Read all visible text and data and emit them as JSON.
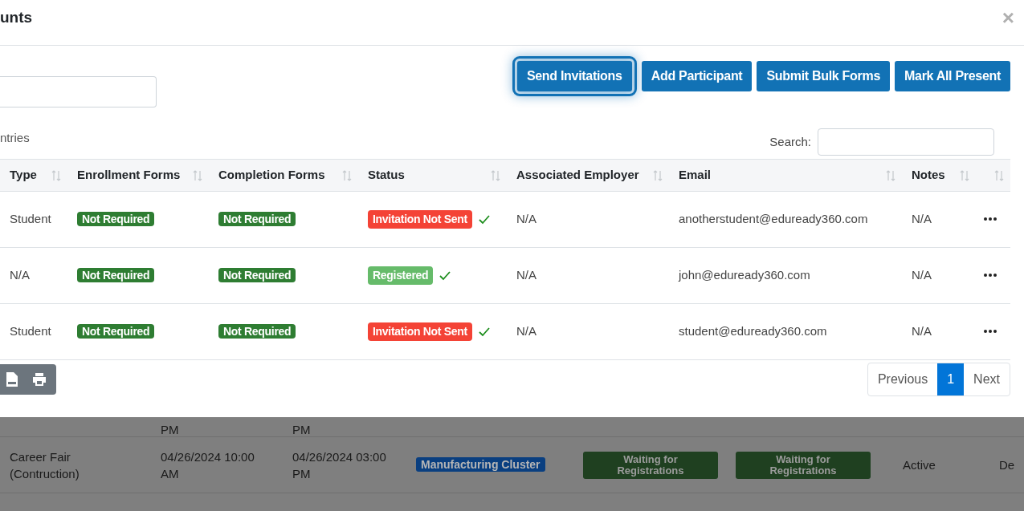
{
  "modal": {
    "title": "unts",
    "close": "×",
    "actions": [
      {
        "label": "Send Invitations",
        "focused": true
      },
      {
        "label": "Add Participant",
        "focused": false
      },
      {
        "label": "Submit Bulk Forms",
        "focused": false
      },
      {
        "label": "Mark All Present",
        "focused": false
      }
    ],
    "entries_label": "ntries",
    "search_label": "Search:",
    "columns": [
      "Type",
      "Enrollment Forms",
      "Completion Forms",
      "Status",
      "Associated Employer",
      "Email",
      "Notes",
      ""
    ],
    "rows": [
      {
        "type": "Student",
        "enrollment": "Not Required",
        "completion": "Not Required",
        "status": {
          "label": "Invitation Not Sent",
          "kind": "danger"
        },
        "employer": "N/A",
        "email": "anotherstudent@eduready360.com",
        "notes": "N/A"
      },
      {
        "type": "N/A",
        "enrollment": "Not Required",
        "completion": "Not Required",
        "status": {
          "label": "Registered",
          "kind": "success"
        },
        "employer": "N/A",
        "email": "john@eduready360.com",
        "notes": "N/A"
      },
      {
        "type": "Student",
        "enrollment": "Not Required",
        "completion": "Not Required",
        "status": {
          "label": "Invitation Not Sent",
          "kind": "danger"
        },
        "employer": "N/A",
        "email": "student@eduready360.com",
        "notes": "N/A"
      }
    ],
    "pagination": [
      {
        "label": "Previous",
        "selected": false
      },
      {
        "label": "1",
        "selected": true
      },
      {
        "label": "Next",
        "selected": false
      }
    ]
  },
  "background": {
    "rows": [
      {
        "cells": [
          "",
          "PM",
          "PM",
          "",
          "",
          "",
          "",
          ""
        ]
      },
      {
        "cells": [
          "Career Fair (Contruction)",
          "04/26/2024 10:00 AM",
          "04/26/2024 03:00 PM",
          "Manufacturing Cluster",
          "Waiting for Registrations",
          "Waiting for Registrations",
          "Active",
          "De"
        ]
      }
    ]
  }
}
